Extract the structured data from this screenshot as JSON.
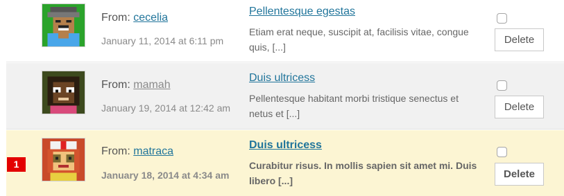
{
  "messages": [
    {
      "from_prefix": "From:",
      "sender": "cecelia",
      "date": "January 11, 2014 at 6:11 pm",
      "subject": "Pellentesque egestas",
      "excerpt": "Etiam erat neque, suscipit at, facilisis vitae, congue quis, [...]",
      "delete_label": "Delete"
    },
    {
      "from_prefix": "From:",
      "sender": "mamah",
      "date": "January 19, 2014 at 12:42 am",
      "subject": "Duis ultricess",
      "excerpt": "Pellentesque habitant morbi tristique senectus et netus et [...]",
      "delete_label": "Delete"
    },
    {
      "from_prefix": "From:",
      "sender": "matraca",
      "date": "January 18, 2014 at 4:34 am",
      "subject": "Duis ultricess",
      "excerpt": "Curabitur risus. In mollis sapien sit amet mi. Duis libero [...]",
      "delete_label": "Delete",
      "badge": "1"
    }
  ],
  "colors": {
    "link": "#21759b",
    "unread_row": "#fcf5d3",
    "alt_row": "#f1f1f1",
    "badge": "#e30000"
  }
}
